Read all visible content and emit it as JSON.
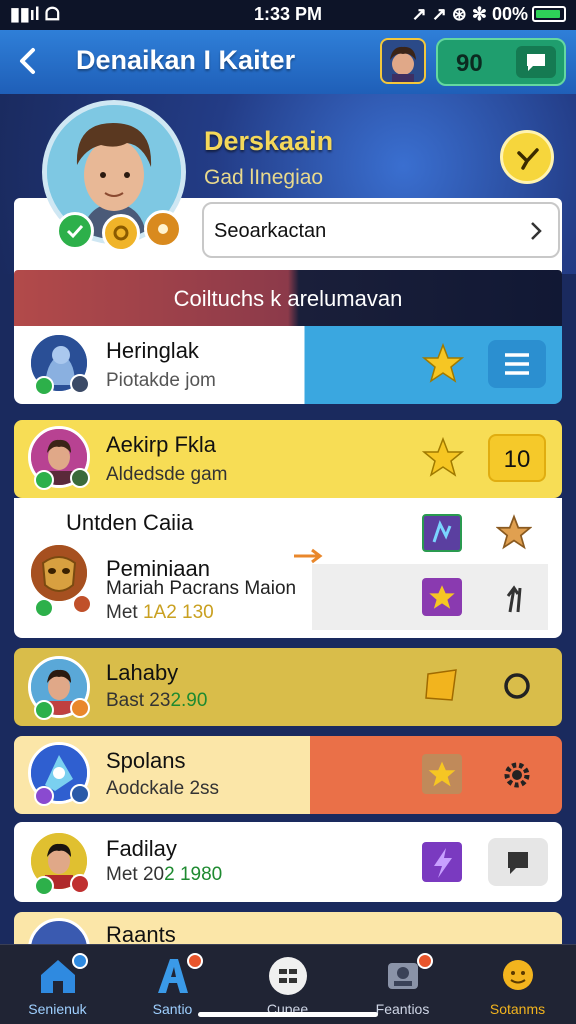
{
  "status": {
    "left": "▮▮ıl ᗝ",
    "time": "1:33 PM",
    "right": "↗ ↗ ⊛ ✻ 00%"
  },
  "header": {
    "title": "Denaikan I Kaiter",
    "coins": "90"
  },
  "profile": {
    "name": "Derskaain",
    "subtitle": "Gad lInegiao"
  },
  "search": {
    "value": "Seoarkactan"
  },
  "section": {
    "title": "Coiltuchs  k arelumavan"
  },
  "cards": [
    {
      "title": "Heringlak",
      "subtitle": "Piotakde jom"
    },
    {
      "title": "Aekirp Fkla",
      "subtitle": "Aldedsde gam",
      "count": "10"
    },
    {
      "title": "Untden Caiia",
      "subtitle": "Peminiaan",
      "line2": "Mariah Pacrans Maion",
      "line3a": "Met ",
      "line3b": "1A2 130"
    },
    {
      "title": "Lahaby",
      "subtitle_a": "Bast 23",
      "subtitle_b": "2.90"
    },
    {
      "title": "Spolans",
      "subtitle": "Aodckale 2ss"
    },
    {
      "title": "Fadilay",
      "subtitle_a": "Met 20",
      "subtitle_b": "2 1980"
    },
    {
      "title": "Raants"
    }
  ],
  "nav": [
    {
      "label": "Senienuk"
    },
    {
      "label": "Santio"
    },
    {
      "label": "Cupee"
    },
    {
      "label": "Feantios"
    },
    {
      "label": "Sotanms"
    }
  ]
}
